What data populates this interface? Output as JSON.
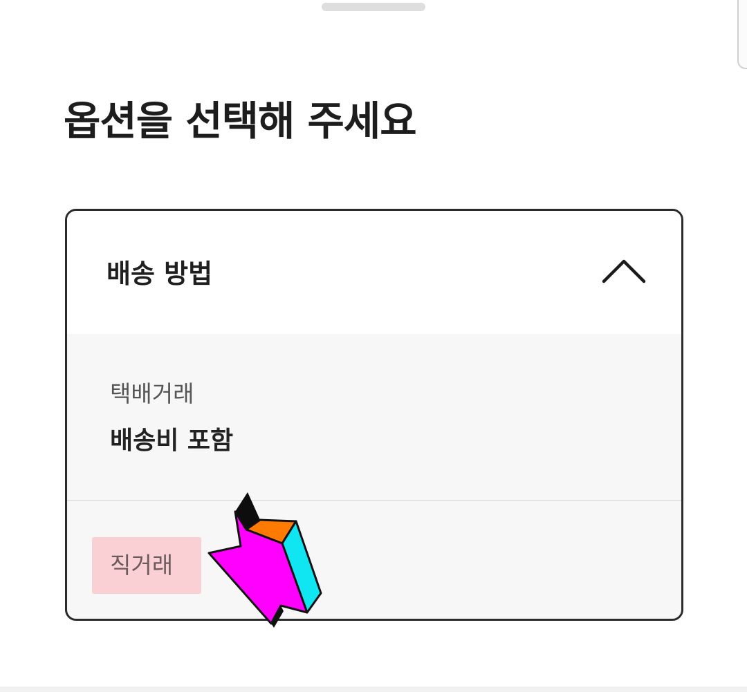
{
  "sheet": {
    "title": "옵션을 선택해 주세요"
  },
  "option_group": {
    "label": "배송 방법",
    "toggle_icon": "chevron-up-icon",
    "expanded": true,
    "options": [
      {
        "name": "택배거래",
        "detail": "배송비 포함"
      },
      {
        "name": "직거래",
        "detail": ""
      }
    ]
  },
  "annotation": {
    "highlight_color": "#ffa0aa",
    "arrow_colors": [
      "#ff00ff",
      "#00e5ff",
      "#ff7a00",
      "#000000"
    ]
  }
}
